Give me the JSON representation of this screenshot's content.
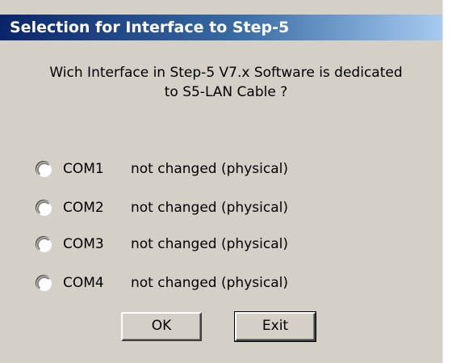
{
  "window": {
    "title": "Selection for Interface to Step-5"
  },
  "question": {
    "line1": "Wich Interface in Step-5 V7.x Software is dedicated",
    "line2": "to  S5-LAN Cable ?"
  },
  "options": [
    {
      "port": "COM1",
      "description": "not changed (physical)",
      "selected": false
    },
    {
      "port": "COM2",
      "description": "not changed (physical)",
      "selected": false
    },
    {
      "port": "COM3",
      "description": "not changed (physical)",
      "selected": false
    },
    {
      "port": "COM4",
      "description": "not changed (physical)",
      "selected": false
    }
  ],
  "buttons": {
    "ok_label": "OK",
    "exit_label": "Exit"
  },
  "colors": {
    "title_bar_start": "#0a246a",
    "title_bar_end": "#a6caf0",
    "dialog_face": "#d4d0c8"
  }
}
